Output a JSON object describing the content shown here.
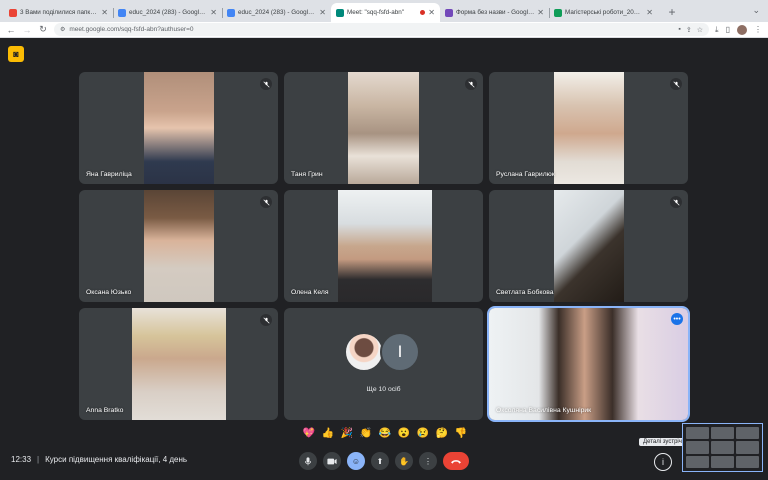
{
  "browser": {
    "tabs": [
      {
        "title": "3 Вами поділилися папкою \"...",
        "favicon_color": "#ea4335",
        "active": false
      },
      {
        "title": "educ_2024 (283) - Google Д...",
        "favicon_color": "#4285f4",
        "active": false
      },
      {
        "title": "educ_2024 (283) - Google Д...",
        "favicon_color": "#4285f4",
        "active": false
      },
      {
        "title": "Meet: \"sqq-fsfd-abn\"",
        "favicon_color": "#00897b",
        "active": true
      },
      {
        "title": "Форма без назви - Google Ф...",
        "favicon_color": "#7248b9",
        "active": false
      },
      {
        "title": "Магістерські роботи_2023 -...",
        "favicon_color": "#0f9d58",
        "active": false
      }
    ],
    "url": "meet.google.com/sqq-fsfd-abn?authuser=0"
  },
  "participants": [
    {
      "name": "Яна Гавриліца",
      "muted": true
    },
    {
      "name": "Таня Грин",
      "muted": true
    },
    {
      "name": "Руслана Гаврилюк",
      "muted": true
    },
    {
      "name": "Оксана Юзько",
      "muted": true
    },
    {
      "name": "Олена Келя",
      "muted": true
    },
    {
      "name": "Светлата Бобкова",
      "muted": true
    },
    {
      "name": "Anna Bratko",
      "muted": true
    },
    {
      "name": "Оксоляна Василівна Кушнірик",
      "muted": false,
      "speaking": true
    }
  ],
  "others": {
    "label": "Ще 10 осіб",
    "avatar_letter": "І"
  },
  "reactions": [
    "💖",
    "👍",
    "🎉",
    "👏",
    "😂",
    "😮",
    "😢",
    "🤔",
    "👎"
  ],
  "bottom": {
    "time": "12:33",
    "meeting_title": "Курси підвищення кваліфікації, 4 день",
    "tooltip": "Деталі зустрічі"
  },
  "icons": {
    "mic": "mic-icon",
    "camera": "camera-icon",
    "emoji": "emoji-icon",
    "present": "present-icon",
    "raise_hand": "hand-icon",
    "more": "more-vert-icon",
    "end_call": "call-end-icon",
    "info": "info-icon"
  }
}
